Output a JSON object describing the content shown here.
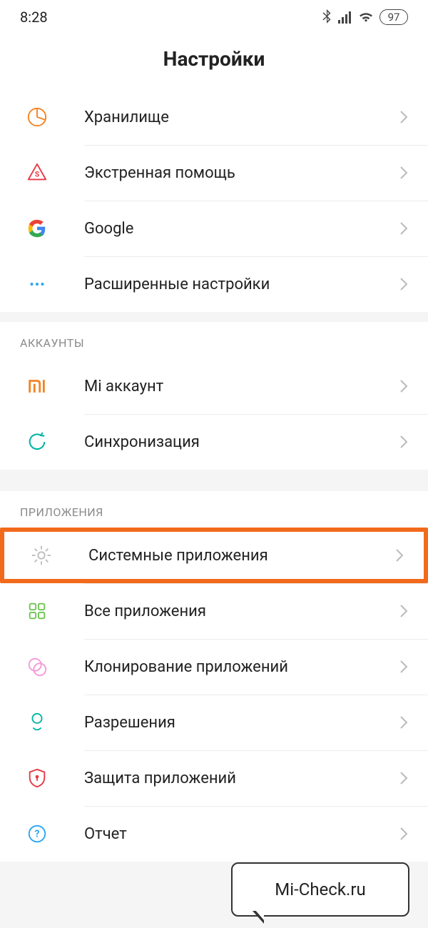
{
  "statusbar": {
    "time": "8:28",
    "battery": "97"
  },
  "header": {
    "title": "Настройки"
  },
  "groups": [
    {
      "header": null,
      "items": [
        {
          "icon": "storage-icon",
          "label": "Хранилище"
        },
        {
          "icon": "sos-icon",
          "label": "Экстренная помощь"
        },
        {
          "icon": "google-icon",
          "label": "Google"
        },
        {
          "icon": "more-icon",
          "label": "Расширенные настройки"
        }
      ]
    },
    {
      "header": "АККАУНТЫ",
      "items": [
        {
          "icon": "mi-icon",
          "label": "Mi аккаунт"
        },
        {
          "icon": "sync-icon",
          "label": "Синхронизация"
        }
      ]
    },
    {
      "header": "ПРИЛОЖЕНИЯ",
      "items": [
        {
          "icon": "gear-icon",
          "label": "Системные приложения",
          "highlight": true
        },
        {
          "icon": "apps-icon",
          "label": "Все приложения"
        },
        {
          "icon": "clone-icon",
          "label": "Клонирование приложений"
        },
        {
          "icon": "permissions-icon",
          "label": "Разрешения"
        },
        {
          "icon": "shield-icon",
          "label": "Защита приложений"
        },
        {
          "icon": "report-icon",
          "label": "Отчет"
        }
      ]
    }
  ],
  "watermark": {
    "text": "Mi-Check.ru"
  },
  "colors": {
    "highlight": "#f26a1b",
    "orange": "#f58220",
    "google_blue": "#4285f4",
    "google_red": "#ea4335",
    "google_yellow": "#fbbc05",
    "google_green": "#34a853",
    "teal": "#00b5a5",
    "pink": "#f59ad8",
    "green": "#6cc551",
    "blue": "#2aa6f0",
    "red": "#e63946",
    "grey": "#bdbdbd"
  }
}
